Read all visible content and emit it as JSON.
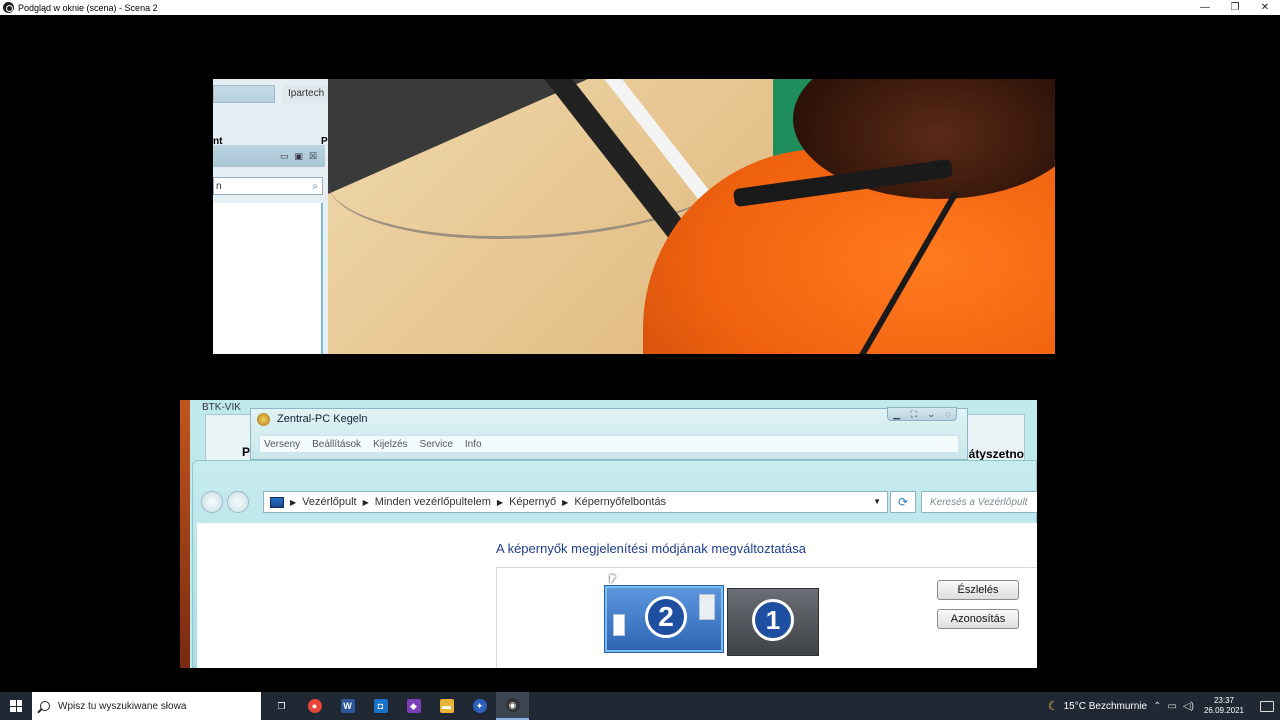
{
  "window": {
    "title": "Podgląd w oknie (scena) - Scena 2",
    "minimize": "—",
    "maximize": "❐",
    "close": "✕"
  },
  "camera_source": {
    "tab_label": "Ipartech",
    "left_label": "nt",
    "right_label": "P",
    "search_placeholder": "n"
  },
  "screen_source": {
    "back_title": "BTK-VIK",
    "back_label_left": "P",
    "back_label_right": "átyszetno",
    "kegeln_title": "Zentral-PC Kegeln",
    "kegeln_menu": [
      "Verseny",
      "Beállítások",
      "Kijelzés",
      "Service",
      "Info"
    ],
    "breadcrumb": [
      "Vezérlőpult",
      "Minden vezérlőpultelem",
      "Képernyő",
      "Képernyőfelbontás"
    ],
    "search_placeholder": "Keresés a Vezérlőpult",
    "heading": "A képernyők megjelenítési módjának megváltoztatása",
    "monitor_2": "2",
    "monitor_1": "1",
    "detect_button": "Észlelés",
    "identify_button": "Azonosítás"
  },
  "taskbar": {
    "search_placeholder": "Wpisz tu wyszukiwane słowa",
    "apps": [
      {
        "name": "task-view-icon",
        "color": "#1f2833",
        "glyph": "❐"
      },
      {
        "name": "chrome-icon",
        "color": "#e8453c",
        "glyph": "●"
      },
      {
        "name": "word-icon",
        "color": "#2b579a",
        "glyph": "W"
      },
      {
        "name": "app-blue-icon",
        "color": "#1a73c8",
        "glyph": "◘"
      },
      {
        "name": "visual-studio-icon",
        "color": "#7b3fb8",
        "glyph": "◆"
      },
      {
        "name": "file-explorer-icon",
        "color": "#e8b43a",
        "glyph": "▬"
      },
      {
        "name": "app-round-icon",
        "color": "#2e5fbd",
        "glyph": "✦"
      },
      {
        "name": "obs-icon",
        "color": "#333333",
        "glyph": "◉"
      }
    ],
    "weather": "15°C  Bezchmurnie",
    "time": "23:37",
    "date": "26.09.2021"
  }
}
